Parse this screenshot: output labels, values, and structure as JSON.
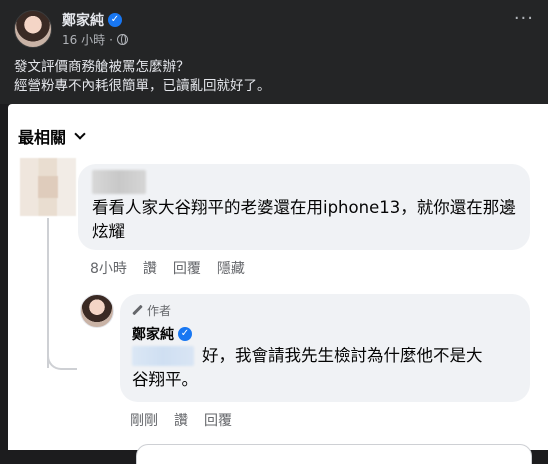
{
  "post": {
    "author": "鄭家純",
    "time": "16 小時",
    "separator": "·",
    "text_line_1": "發文評價商務艙被罵怎麼辦？",
    "text_line_2": "經營粉專不內耗很簡單，已讀亂回就好了。",
    "more_icon": "more-horizontal-icon",
    "privacy_icon": "globe-icon"
  },
  "comments": {
    "sort_label": "最相關",
    "first": {
      "text": "看看人家大谷翔平的老婆還在用iphone13，就你還在那邊炫耀",
      "time": "8小時",
      "like": "讚",
      "reply": "回覆",
      "hide": "隱藏"
    },
    "reply": {
      "badge": "作者",
      "author": "鄭家純",
      "text_line_1": "好，我會請我先生檢討為什麼他不是大",
      "text_line_2": "谷翔平。",
      "time": "剛剛",
      "like": "讚",
      "reply": "回覆"
    }
  },
  "colors": {
    "header_bg": "#242526",
    "bubble_bg": "#f0f2f5",
    "verified": "#1877f2",
    "meta_text": "#65676b"
  }
}
